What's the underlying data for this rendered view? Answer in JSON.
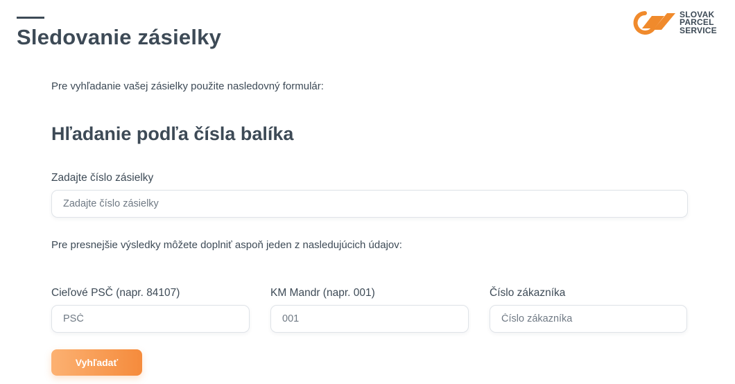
{
  "header": {
    "title": "Sledovanie zásielky",
    "logo": {
      "lines": [
        "SLOVAK",
        "PARCEL",
        "SERVICE"
      ],
      "accent_color": "#f08a2c"
    }
  },
  "intro_text": "Pre vyhľadanie vašej zásielky použite nasledovný formulár:",
  "section": {
    "title": "Hľadanie podľa čísla balíka",
    "parcel": {
      "label": "Zadajte číslo zásielky",
      "placeholder": "Zadajte číslo zásielky",
      "value": ""
    },
    "hint": "Pre presnejšie výsledky môžete doplniť aspoň jeden z nasledujúcich údajov:",
    "fields": [
      {
        "label": "Cieľové PSČ (napr. 84107)",
        "placeholder": "PSČ",
        "value": ""
      },
      {
        "label": "KM Mandr (napr. 001)",
        "placeholder": "001",
        "value": ""
      },
      {
        "label": "Číslo zákazníka",
        "placeholder": "Číslo zákazníka",
        "value": ""
      }
    ],
    "search_button": "Vyhľadať"
  },
  "colors": {
    "text": "#3d4a56",
    "button_gradient_start": "#fcb172",
    "button_gradient_end": "#f58b3c",
    "input_border": "#dfe3e8"
  }
}
